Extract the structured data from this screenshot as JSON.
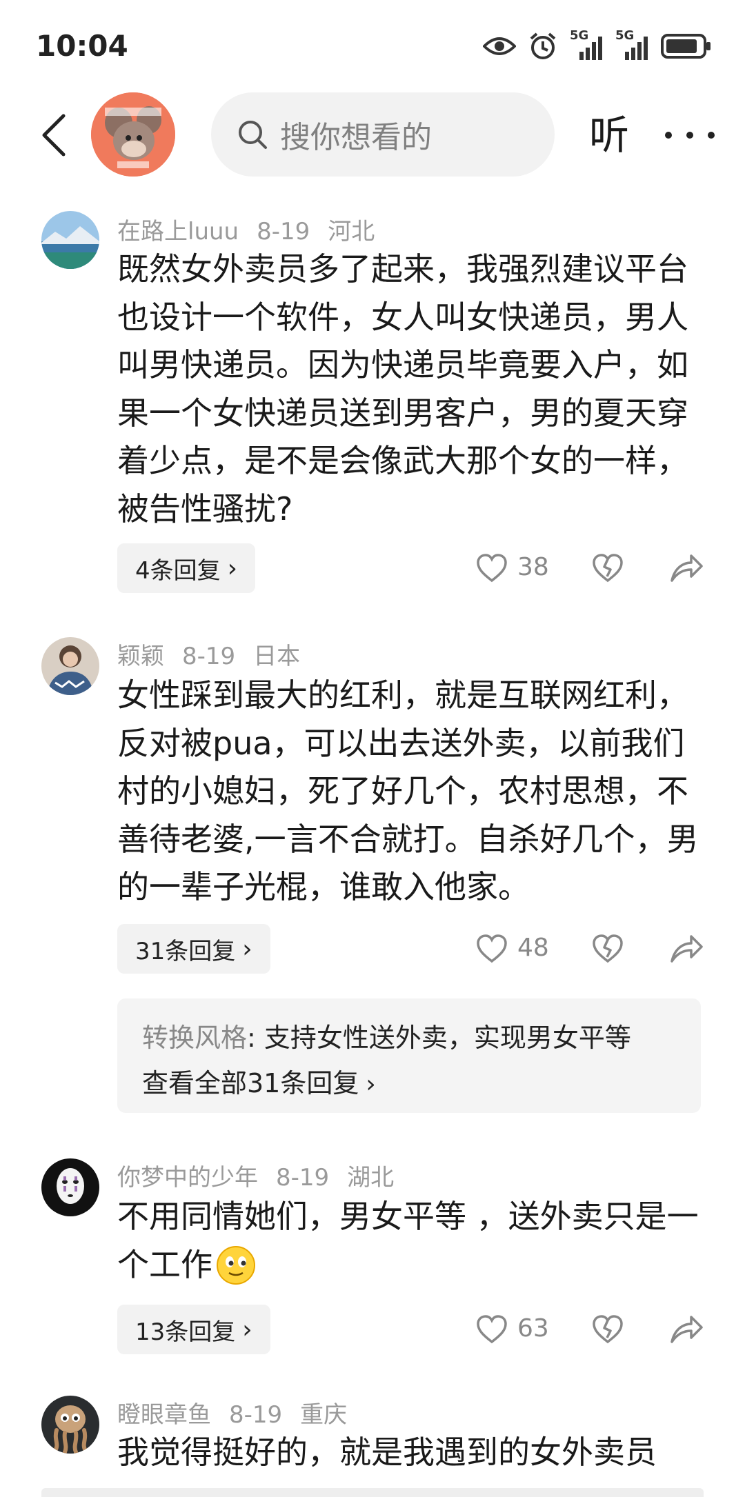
{
  "status_bar": {
    "time": "10:04",
    "network_label": "5G"
  },
  "nav": {
    "search_placeholder": "搜你想看的",
    "listen_label": "听"
  },
  "comments": [
    {
      "username": "在路上luuu",
      "date": "8-19",
      "location": "河北",
      "text": "既然女外卖员多了起来，我强烈建议平台也设计一个软件，女人叫女快递员，男人叫男快递员。因为快递员毕竟要入户，如果一个女快递员送到男客户，男的夏天穿着少点，是不是会像武大那个女的一样，被告性骚扰?",
      "replies_label": "4条回复",
      "likes": "38"
    },
    {
      "username": "颖颖",
      "date": "8-19",
      "location": "日本",
      "text": "女性踩到最大的红利，就是互联网红利，反对被pua，可以出去送外卖，以前我们村的小媳妇，死了好几个，农村思想，不善待老婆,一言不合就打。自杀好几个，男的一辈子光棍，谁敢入他家。",
      "replies_label": "31条回复",
      "likes": "48",
      "reply_preview": {
        "author": "转换风格",
        "text": ": 支持女性送外卖，实现男女平等",
        "view_all": "查看全部31条回复"
      }
    },
    {
      "username": "你梦中的少年",
      "date": "8-19",
      "location": "湖北",
      "text": "不用同情她们，男女平等 ，送外卖只是一个工作",
      "replies_label": "13条回复",
      "likes": "63"
    },
    {
      "username": "瞪眼章鱼",
      "date": "8-19",
      "location": "重庆",
      "text": "我觉得挺好的，就是我遇到的女外卖员"
    }
  ],
  "colors": {
    "meta_gray": "#9a9a9a",
    "chip_bg": "#f2f2f2",
    "text": "#1a1a1a"
  }
}
